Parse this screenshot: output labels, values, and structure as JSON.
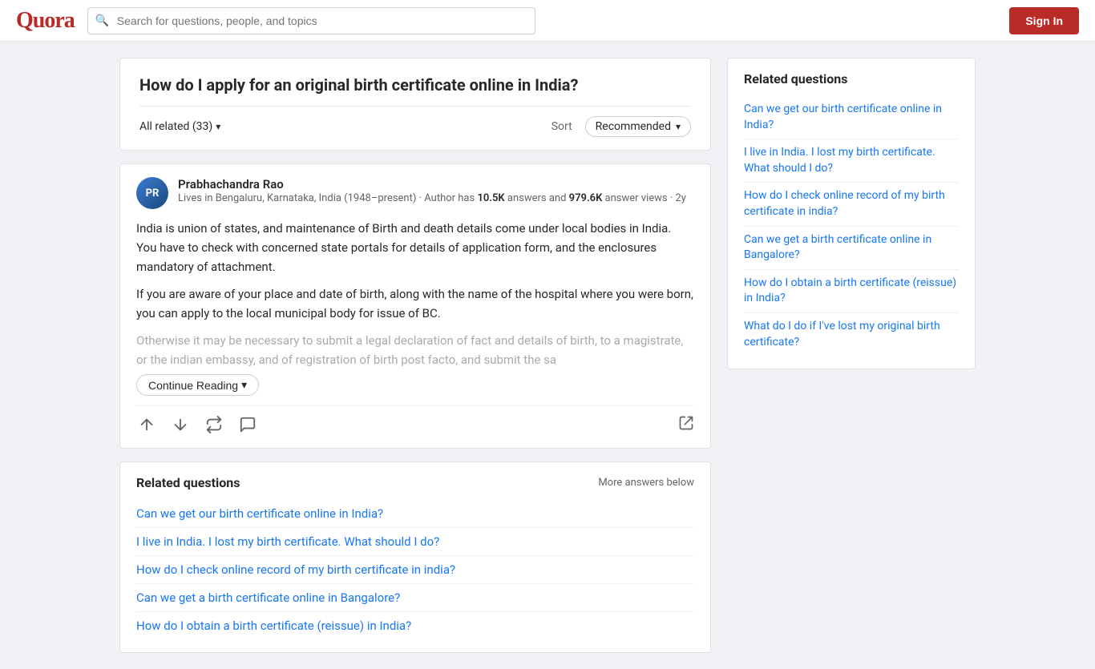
{
  "header": {
    "logo": "Quora",
    "search_placeholder": "Search for questions, people, and topics",
    "sign_in_label": "Sign In"
  },
  "question": {
    "title": "How do I apply for an original birth certificate online in India?",
    "all_related_label": "All related (33)",
    "sort_label": "Sort",
    "sort_value": "Recommended"
  },
  "answer": {
    "author_name": "Prabhachandra Rao",
    "author_initials": "PR",
    "author_bio_text": "Lives in Bengaluru, Karnataka, India (1948–present) · Author has ",
    "author_answers": "10.5K",
    "author_bio_mid": " answers and ",
    "author_views": "979.6K",
    "author_bio_end": " answer views · 2y",
    "paragraph1": "India is union of states, and maintenance of Birth and death details come under local bodies in India. You have to check with concerned state portals for details of application form, and the enclosures mandatory of attachment.",
    "paragraph2": "If you are aware of your place and date of birth, along with the name of the hospital where you were born, you can apply to the local municipal body for issue of BC.",
    "paragraph3_faded": "Otherwise it may be necessary to submit a legal declaration of fact and details of birth, to a magistrate, or the indian embassy, and of registration of birth post facto, and submit the sa",
    "continue_reading_label": "Continue Reading"
  },
  "related_main": {
    "title": "Related questions",
    "more_answers_label": "More answers below",
    "links": [
      "Can we get our birth certificate online in India?",
      "I live in India. I lost my birth certificate. What should I do?",
      "How do I check online record of my birth certificate in india?",
      "Can we get a birth certificate online in Bangalore?",
      "How do I obtain a birth certificate (reissue) in India?"
    ]
  },
  "sidebar": {
    "title": "Related questions",
    "links": [
      "Can we get our birth certificate online in India?",
      "I live in India. I lost my birth certificate. What should I do?",
      "How do I check online record of my birth certificate in india?",
      "Can we get a birth certificate online in Bangalore?",
      "How do I obtain a birth certificate (reissue) in India?",
      "What do I do if I've lost my original birth certificate?"
    ]
  },
  "icons": {
    "search": "🔍",
    "chevron_down": "▾",
    "upvote": "↑",
    "downvote": "↓",
    "share_alt": "↗",
    "comment": "💬",
    "refresh": "↻"
  }
}
